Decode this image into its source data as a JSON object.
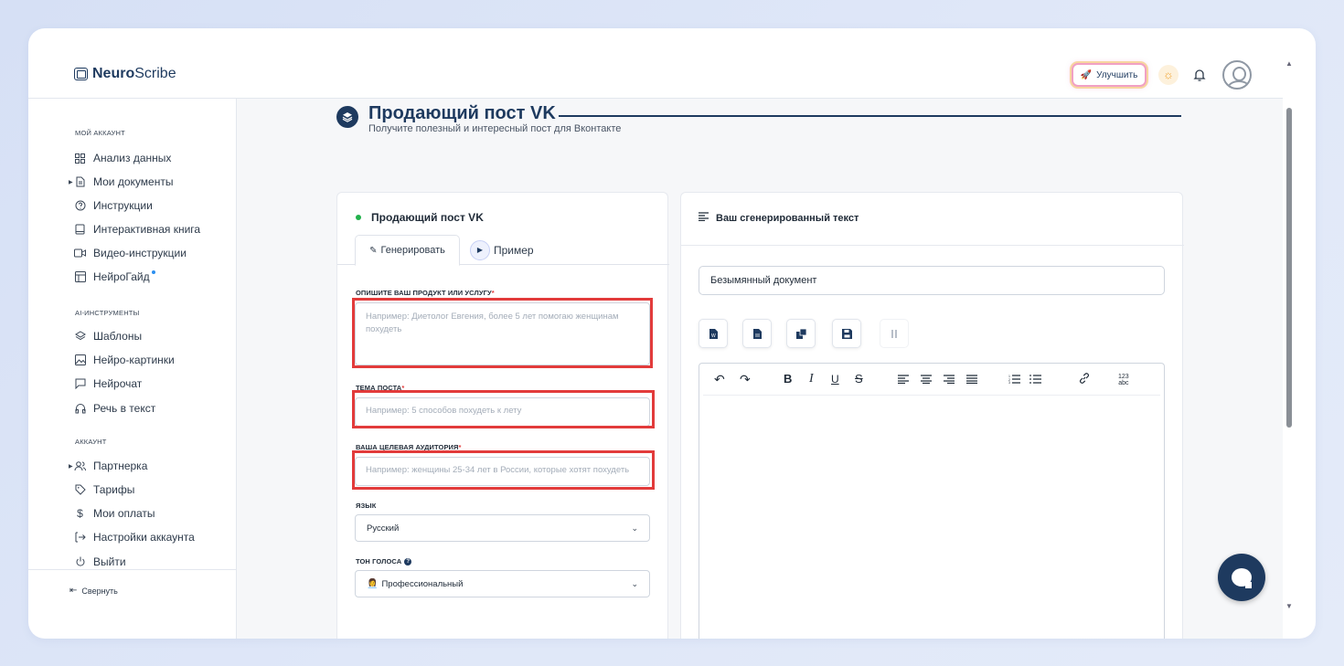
{
  "header": {
    "logo_bold": "Neuro",
    "logo_rest": "Scribe",
    "upgrade_label": "Улучшить"
  },
  "sidebar": {
    "section_account": "МОЙ АККАУНТ",
    "account_items": [
      {
        "label": "Анализ данных",
        "icon": "grid-icon"
      },
      {
        "label": "Мои документы",
        "icon": "document-icon"
      },
      {
        "label": "Инструкции",
        "icon": "help-icon"
      },
      {
        "label": "Интерактивная книга",
        "icon": "book-icon"
      },
      {
        "label": "Видео-инструкции",
        "icon": "video-icon"
      },
      {
        "label": "НейроГайд",
        "icon": "guide-icon"
      }
    ],
    "section_ai": "AI-ИНСТРУМЕНТЫ",
    "ai_items": [
      {
        "label": "Шаблоны",
        "icon": "layers-icon"
      },
      {
        "label": "Нейро-картинки",
        "icon": "image-icon"
      },
      {
        "label": "Нейрочат",
        "icon": "chat-icon"
      },
      {
        "label": "Речь в текст",
        "icon": "headphones-icon"
      }
    ],
    "section_acc2": "АККАУНТ",
    "acc2_items": [
      {
        "label": "Партнерка",
        "icon": "users-icon"
      },
      {
        "label": "Тарифы",
        "icon": "tag-icon"
      },
      {
        "label": "Мои оплаты",
        "icon": "dollar-icon"
      },
      {
        "label": "Настройки аккаунта",
        "icon": "settings-icon"
      },
      {
        "label": "Выйти",
        "icon": "power-icon"
      }
    ],
    "collapse_label": "Свернуть"
  },
  "page": {
    "title": "Продающий пост VK",
    "subtitle": "Получите полезный и интересный пост для Вконтакте"
  },
  "form": {
    "card_title": "Продающий пост VK",
    "tab_generate": "Генерировать",
    "tab_example": "Пример",
    "product_label": "ОПИШИТЕ ВАШ ПРОДУКТ ИЛИ УСЛУГУ",
    "product_placeholder": "Например: Диетолог Евгения, более 5 лет помогаю женщинам похудеть",
    "topic_label": "ТЕМА ПОСТА",
    "topic_placeholder": "Например: 5 способов похудеть к лету",
    "audience_label": "ВАША ЦЕЛЕВАЯ АУДИТОРИЯ",
    "audience_placeholder": "Например: женщины 25-34 лет в России, которые хотят похудеть",
    "language_label": "ЯЗЫК",
    "language_value": "Русский",
    "tone_label": "ТОН ГОЛОСА",
    "tone_value": "Профессиональный",
    "required_mark": "*"
  },
  "output": {
    "title": "Ваш сгенерированный текст",
    "doc_name": "Безымянный документ"
  },
  "colors": {
    "brand": "#1e3a5f",
    "highlight": "#e23b3b",
    "status_dot": "#22b14c"
  }
}
